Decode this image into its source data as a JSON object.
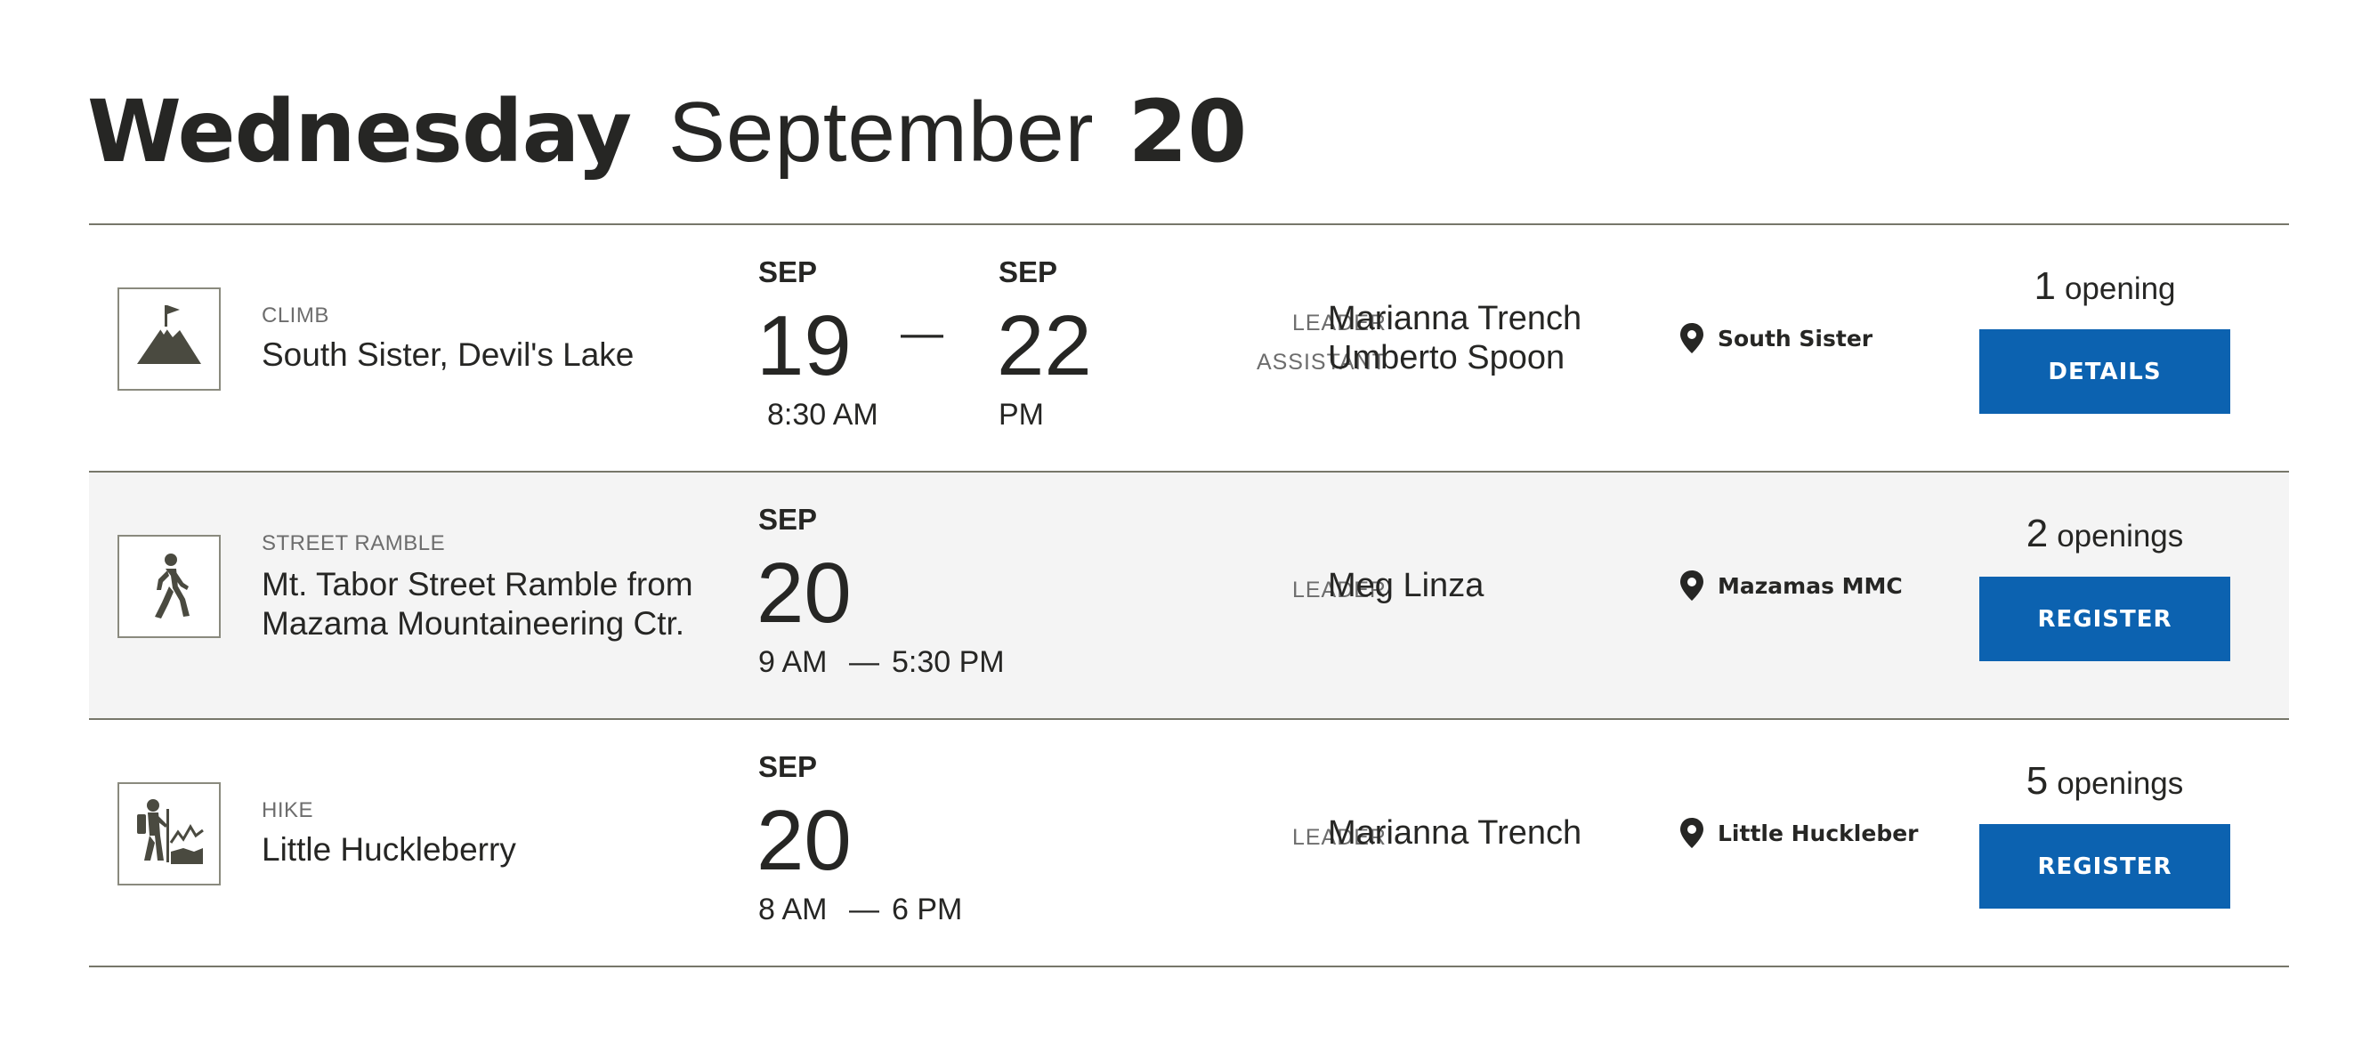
{
  "heading": {
    "weekday": "Wednesday",
    "month": "September",
    "day": "20"
  },
  "events": [
    {
      "icon": "climb-icon",
      "type": "CLIMB",
      "title": "South Sister, Devil's Lake",
      "start_month": "SEP",
      "start_day": "19",
      "start_time": "8:30 AM",
      "dash": "—",
      "end_month": "SEP",
      "end_day": "22",
      "end_time": "PM",
      "leader_label": "LEADER",
      "leader": "Marianna Trench",
      "assistant_label": "ASSISTANT",
      "assistant": "Umberto Spoon",
      "location": "South Sister",
      "openings_count": "1",
      "openings_word": "opening",
      "button": "DETAILS"
    },
    {
      "icon": "walker-icon",
      "type": "STREET RAMBLE",
      "title": "Mt. Tabor Street Ramble from Mazama Mountaineering Ctr.",
      "month": "SEP",
      "day": "20",
      "time_start": "9 AM",
      "time_dash": "—",
      "time_end": "5:30 PM",
      "leader_label": "LEADER",
      "leader": "Meg Linza",
      "location": "Mazamas MMC",
      "openings_count": "2",
      "openings_word": "openings",
      "button": "REGISTER"
    },
    {
      "icon": "hiker-icon",
      "type": "HIKE",
      "title": "Little Huckleberry",
      "month": "SEP",
      "day": "20",
      "time_start": "8 AM",
      "time_dash": "—",
      "time_end": "6 PM",
      "leader_label": "LEADER",
      "leader": "Marianna Trench",
      "location": "Little Huckleber",
      "openings_count": "5",
      "openings_word": "openings",
      "button": "REGISTER"
    }
  ],
  "colors": {
    "button": "#0c62b0",
    "rule": "#77776a",
    "shaded_row": "#f4f4f4",
    "icon": "#4a4a40"
  }
}
